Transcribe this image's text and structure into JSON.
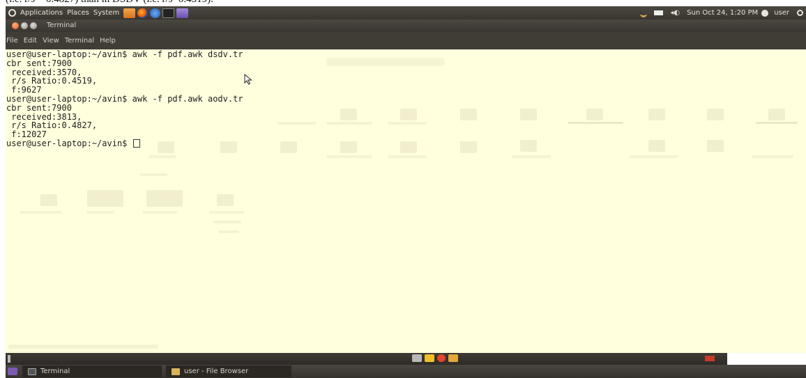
{
  "caption_fragment": "(i.e. r/s = 0.4827) than in DSDV (i.e. r/s=0.4519).",
  "top_panel": {
    "menus": [
      "Applications",
      "Places",
      "System"
    ],
    "launchers": [
      "files-launcher-icon",
      "firefox-icon",
      "help-icon",
      "terminal-launcher-icon",
      "monitor-icon"
    ],
    "tray": {
      "datetime": "Sun Oct 24,  1:20 PM",
      "user": "user"
    }
  },
  "window": {
    "title": "Terminal",
    "menu": [
      "File",
      "Edit",
      "View",
      "Terminal",
      "Help"
    ]
  },
  "terminal": {
    "lines": [
      "user@user-laptop:~/avin$ awk -f pdf.awk dsdv.tr",
      "cbr sent:7900",
      " received:3570,",
      " r/s Ratio:0.4519,",
      " f:9627",
      "user@user-laptop:~/avin$ awk -f pdf.awk aodv.tr",
      "cbr sent:7900",
      " received:3813,",
      " r/s Ratio:0.4827,",
      " f:12027"
    ],
    "prompt": "user@user-laptop:~/avin$ "
  },
  "taskbar": {
    "tasks": [
      {
        "label": "Terminal",
        "active": true
      },
      {
        "label": "user - File Browser",
        "active": false
      }
    ]
  },
  "colors": {
    "terminal_bg": "#ffffde",
    "panel_bg": "#3c3832",
    "accent": "#e2581b"
  }
}
